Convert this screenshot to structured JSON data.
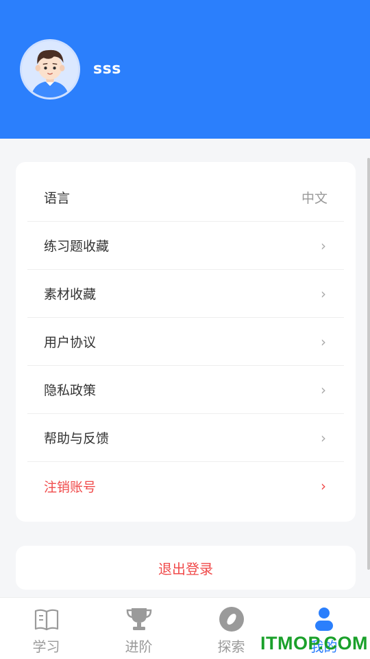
{
  "profile": {
    "username": "sss"
  },
  "menu": {
    "items": [
      {
        "label": "语言",
        "value": "中文"
      },
      {
        "label": "练习题收藏",
        "chevron": "›"
      },
      {
        "label": "素材收藏",
        "chevron": "›"
      },
      {
        "label": "用户协议",
        "chevron": "›"
      },
      {
        "label": "隐私政策",
        "chevron": "›"
      },
      {
        "label": "帮助与反馈",
        "chevron": "›"
      },
      {
        "label": "注销账号",
        "chevron": "›"
      }
    ]
  },
  "logout": {
    "label": "退出登录"
  },
  "bottom_nav": {
    "items": [
      {
        "label": "学习",
        "icon": "book-icon"
      },
      {
        "label": "进阶",
        "icon": "trophy-icon"
      },
      {
        "label": "探索",
        "icon": "compass-icon"
      },
      {
        "label": "我的",
        "icon": "user-icon",
        "active": true
      }
    ]
  },
  "watermark": {
    "text": "ITMOP.COM"
  },
  "colors": {
    "primary": "#2b7ffc",
    "danger": "#f04a4a",
    "background": "#f5f6f8",
    "watermark": "#1aa02a"
  }
}
